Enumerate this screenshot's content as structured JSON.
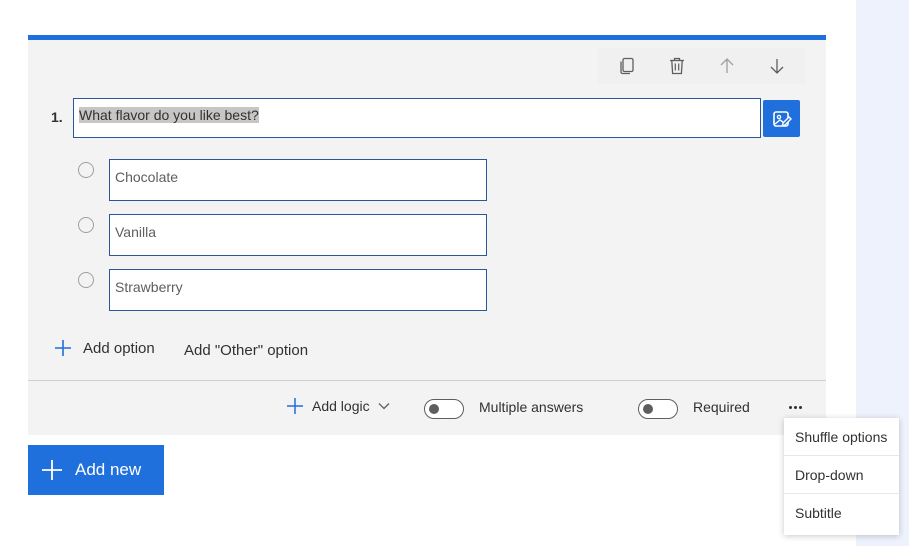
{
  "question": {
    "number": "1.",
    "text": "What flavor do you like best?"
  },
  "toolbar": {
    "copy_icon": "copy-icon",
    "delete_icon": "trash-icon",
    "up_icon": "arrow-up-icon",
    "down_icon": "arrow-down-icon"
  },
  "options": [
    {
      "label": "Chocolate"
    },
    {
      "label": "Vanilla"
    },
    {
      "label": "Strawberry"
    }
  ],
  "actions": {
    "add_option": "Add option",
    "add_other_option": "Add \"Other\" option",
    "add_logic": "Add logic",
    "multiple_answers": "Multiple answers",
    "required": "Required",
    "add_new": "Add new"
  },
  "menu": {
    "items": [
      "Shuffle options",
      "Drop-down",
      "Subtitle"
    ]
  },
  "colors": {
    "accent": "#1f6fdc",
    "card_bg": "#f3f3f3"
  }
}
